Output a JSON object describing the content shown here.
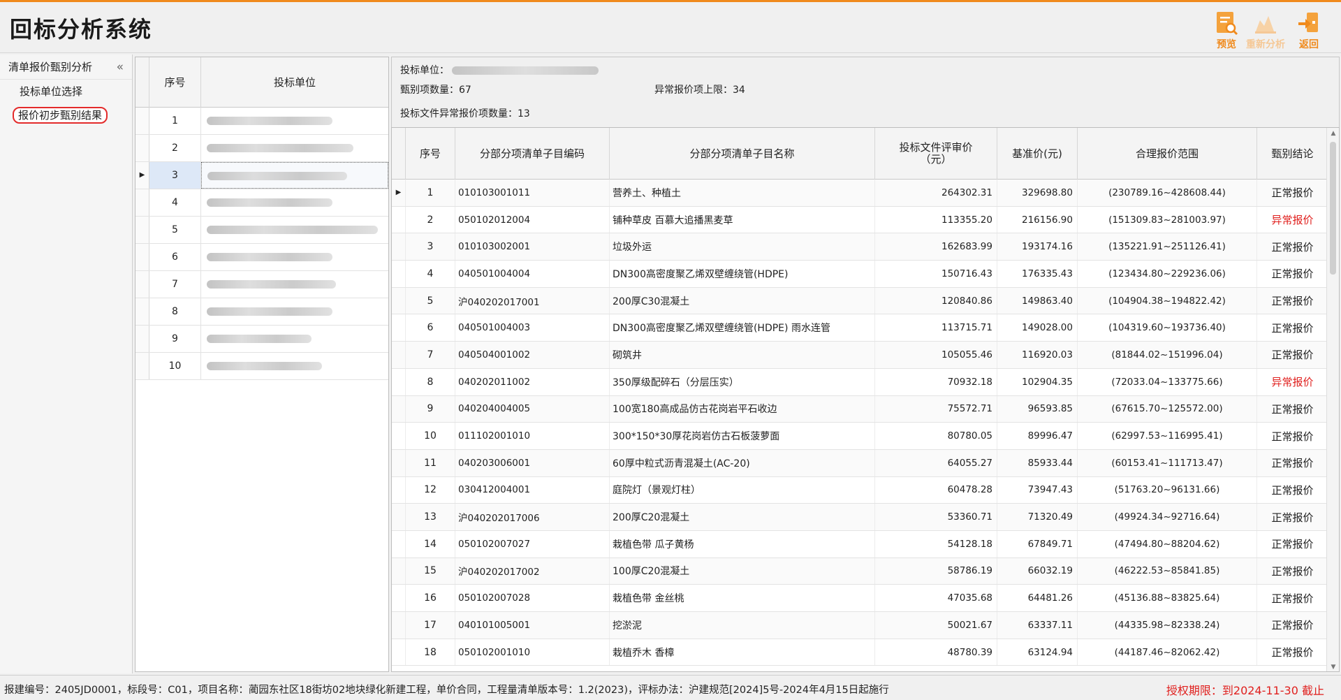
{
  "app": {
    "title": "回标分析系统"
  },
  "toolbar": {
    "preview_label": "预览",
    "reanalyze_label": "重新分析",
    "back_label": "返回",
    "accent_color": "#f08a1c"
  },
  "nav": {
    "header": "清单报价甄别分析",
    "collapse_icon": "«",
    "items": [
      {
        "label": "投标单位选择",
        "active": false
      },
      {
        "label": "报价初步甄别结果",
        "active": true
      }
    ]
  },
  "bidders": {
    "header_seq": "序号",
    "header_unit": "投标单位",
    "rows": [
      {
        "seq": "1",
        "unit": ""
      },
      {
        "seq": "2",
        "unit": ""
      },
      {
        "seq": "3",
        "unit": "",
        "selected": true
      },
      {
        "seq": "4",
        "unit": ""
      },
      {
        "seq": "5",
        "unit": ""
      },
      {
        "seq": "6",
        "unit": ""
      },
      {
        "seq": "7",
        "unit": ""
      },
      {
        "seq": "8",
        "unit": ""
      },
      {
        "seq": "9",
        "unit": ""
      },
      {
        "seq": "10",
        "unit": ""
      }
    ]
  },
  "summary": {
    "bidder_label": "投标单位：",
    "screen_count_label": "甄别项数量：",
    "screen_count": "67",
    "abnormal_limit_label": "异常报价项上限：",
    "abnormal_limit": "34",
    "abnormal_count_label": "投标文件异常报价项数量：",
    "abnormal_count": "13"
  },
  "grid": {
    "headers": {
      "seq": "序号",
      "code": "分部分项清单子目编码",
      "name": "分部分项清单子目名称",
      "bid": "投标文件评审价（元）",
      "base": "基准价(元)",
      "range": "合理报价范围",
      "conclusion": "甄别结论"
    },
    "rows": [
      {
        "seq": "1",
        "code": "010103001011",
        "name": "营养土、种植土",
        "bid": "264302.31",
        "base": "329698.80",
        "range": "(230789.16~428608.44)",
        "conclusion": "正常报价",
        "abnormal": false,
        "current": true
      },
      {
        "seq": "2",
        "code": "050102012004",
        "name": "铺种草皮 百慕大追播黑麦草",
        "bid": "113355.20",
        "base": "216156.90",
        "range": "(151309.83~281003.97)",
        "conclusion": "异常报价",
        "abnormal": true
      },
      {
        "seq": "3",
        "code": "010103002001",
        "name": "垃圾外运",
        "bid": "162683.99",
        "base": "193174.16",
        "range": "(135221.91~251126.41)",
        "conclusion": "正常报价",
        "abnormal": false
      },
      {
        "seq": "4",
        "code": "040501004004",
        "name": "DN300高密度聚乙烯双壁缠绕管(HDPE)",
        "bid": "150716.43",
        "base": "176335.43",
        "range": "(123434.80~229236.06)",
        "conclusion": "正常报价",
        "abnormal": false
      },
      {
        "seq": "5",
        "code": "沪040202017001",
        "name": "200厚C30混凝土",
        "bid": "120840.86",
        "base": "149863.40",
        "range": "(104904.38~194822.42)",
        "conclusion": "正常报价",
        "abnormal": false
      },
      {
        "seq": "6",
        "code": "040501004003",
        "name": "DN300高密度聚乙烯双壁缠绕管(HDPE) 雨水连管",
        "bid": "113715.71",
        "base": "149028.00",
        "range": "(104319.60~193736.40)",
        "conclusion": "正常报价",
        "abnormal": false
      },
      {
        "seq": "7",
        "code": "040504001002",
        "name": "砌筑井",
        "bid": "105055.46",
        "base": "116920.03",
        "range": "(81844.02~151996.04)",
        "conclusion": "正常报价",
        "abnormal": false
      },
      {
        "seq": "8",
        "code": "040202011002",
        "name": "350厚级配碎石（分层压实）",
        "bid": "70932.18",
        "base": "102904.35",
        "range": "(72033.04~133775.66)",
        "conclusion": "异常报价",
        "abnormal": true
      },
      {
        "seq": "9",
        "code": "040204004005",
        "name": "100宽180高成品仿古花岗岩平石收边",
        "bid": "75572.71",
        "base": "96593.85",
        "range": "(67615.70~125572.00)",
        "conclusion": "正常报价",
        "abnormal": false
      },
      {
        "seq": "10",
        "code": "011102001010",
        "name": "300*150*30厚花岗岩仿古石板菠萝面",
        "bid": "80780.05",
        "base": "89996.47",
        "range": "(62997.53~116995.41)",
        "conclusion": "正常报价",
        "abnormal": false
      },
      {
        "seq": "11",
        "code": "040203006001",
        "name": "60厚中粒式沥青混凝土(AC-20)",
        "bid": "64055.27",
        "base": "85933.44",
        "range": "(60153.41~111713.47)",
        "conclusion": "正常报价",
        "abnormal": false
      },
      {
        "seq": "12",
        "code": "030412004001",
        "name": "庭院灯（景观灯柱）",
        "bid": "60478.28",
        "base": "73947.43",
        "range": "(51763.20~96131.66)",
        "conclusion": "正常报价",
        "abnormal": false
      },
      {
        "seq": "13",
        "code": "沪040202017006",
        "name": "200厚C20混凝土",
        "bid": "53360.71",
        "base": "71320.49",
        "range": "(49924.34~92716.64)",
        "conclusion": "正常报价",
        "abnormal": false
      },
      {
        "seq": "14",
        "code": "050102007027",
        "name": "栽植色带 瓜子黄杨",
        "bid": "54128.18",
        "base": "67849.71",
        "range": "(47494.80~88204.62)",
        "conclusion": "正常报价",
        "abnormal": false
      },
      {
        "seq": "15",
        "code": "沪040202017002",
        "name": "100厚C20混凝土",
        "bid": "58786.19",
        "base": "66032.19",
        "range": "(46222.53~85841.85)",
        "conclusion": "正常报价",
        "abnormal": false
      },
      {
        "seq": "16",
        "code": "050102007028",
        "name": "栽植色带 金丝桃",
        "bid": "47035.68",
        "base": "64481.26",
        "range": "(45136.88~83825.64)",
        "conclusion": "正常报价",
        "abnormal": false
      },
      {
        "seq": "17",
        "code": "040101005001",
        "name": "挖淤泥",
        "bid": "50021.67",
        "base": "63337.11",
        "range": "(44335.98~82338.24)",
        "conclusion": "正常报价",
        "abnormal": false
      },
      {
        "seq": "18",
        "code": "050102001010",
        "name": "栽植乔木 香樟",
        "bid": "48780.39",
        "base": "63124.94",
        "range": "(44187.46~82062.42)",
        "conclusion": "正常报价",
        "abnormal": false
      }
    ]
  },
  "status": {
    "text": "报建编号：2405JD0001，标段号：C01，项目名称：蔺园东社区18街坊02地块绿化新建工程，单价合同，工程量清单版本号：1.2(2023)，评标办法：沪建规范[2024]5号-2024年4月15日起施行",
    "license": "授权期限：到2024-11-30 截止",
    "license_color": "#e0201e"
  }
}
